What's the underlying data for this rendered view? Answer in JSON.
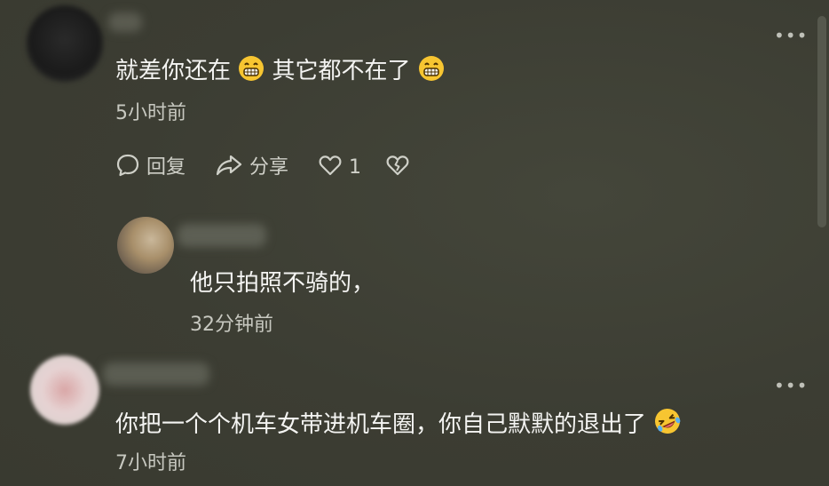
{
  "comments": [
    {
      "text": "就差你还在",
      "text_after": "其它都不在了",
      "time": "5小时前",
      "emoji": "grin-icon",
      "actions": {
        "reply_label": "回复",
        "share_label": "分享",
        "like_count": "1"
      }
    },
    {
      "text": "他只拍照不骑的，",
      "time": "32分钟前"
    },
    {
      "text": "你把一个个机车女带进机车圈，你自己默默的退出了",
      "emoji": "rofl-icon",
      "time": "7小时前"
    }
  ],
  "more_label": "•••"
}
